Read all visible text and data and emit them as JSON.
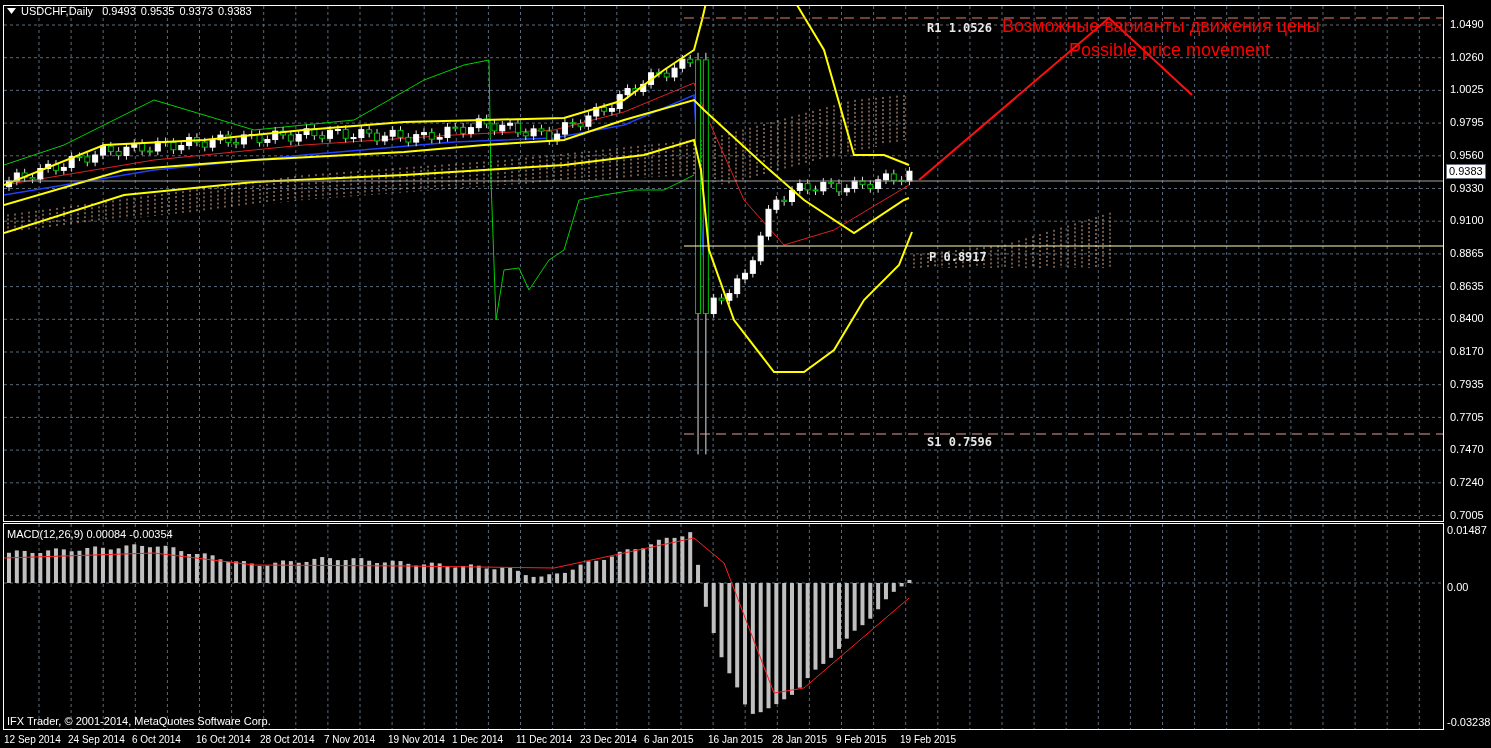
{
  "chart_header": {
    "symbol": "USDCHF,Daily",
    "ohlc": [
      "0.9493",
      "0.9535",
      "0.9373",
      "0.9383"
    ]
  },
  "annotations": [
    {
      "kind": "pivot",
      "text": "R1 1.0526"
    },
    {
      "kind": "pivot",
      "text": "P 0.8917"
    },
    {
      "kind": "pivot",
      "text": "S1 0.7596"
    },
    {
      "kind": "note",
      "text": "Возможные варианты движения цены"
    },
    {
      "kind": "note",
      "text": "Possible price movement"
    }
  ],
  "price_axis": {
    "ticks": [
      "1.0490",
      "1.0260",
      "1.0025",
      "0.9795",
      "0.9560",
      "0.9330",
      "0.9100",
      "0.8865",
      "0.8635",
      "0.8400",
      "0.8170",
      "0.7935",
      "0.7705",
      "0.7470",
      "0.7240",
      "0.7005"
    ],
    "current_price": "0.9383"
  },
  "macd_panel": {
    "title": "MACD(12,26,9) 0.00084 -0.00354",
    "ticks": [
      "0.01487",
      "0.00",
      "-0.03238"
    ],
    "copyright": "IFX Trader, © 2001-2014, MetaQuotes Software Corp."
  },
  "time_axis": {
    "ticks": [
      "12 Sep 2014",
      "24 Sep 2014",
      "6 Oct 2014",
      "16 Oct 2014",
      "28 Oct 2014",
      "7 Nov 2014",
      "19 Nov 2014",
      "1 Dec 2014",
      "11 Dec 2014",
      "23 Dec 2014",
      "6 Jan 2015",
      "16 Jan 2015",
      "28 Jan 2015",
      "9 Feb 2015",
      "19 Feb 2015"
    ]
  }
}
